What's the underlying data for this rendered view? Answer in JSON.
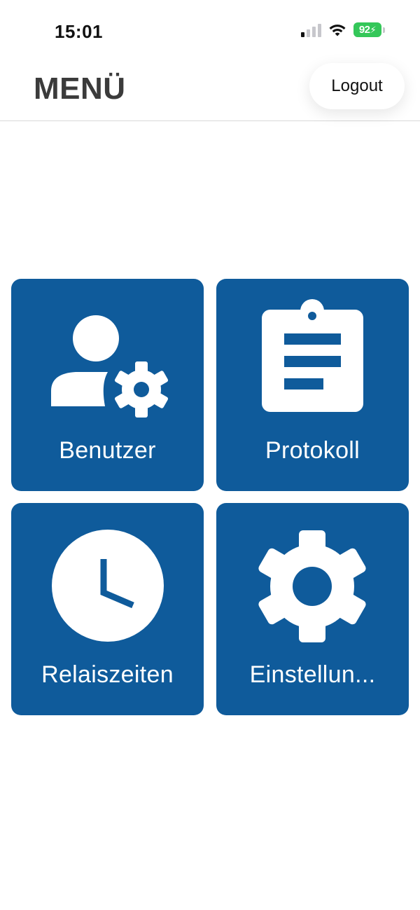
{
  "status_bar": {
    "time": "15:01",
    "battery_percent": "92",
    "signal_bars_active": 1,
    "signal_bars_total": 4,
    "icons": [
      "cellular-signal-icon",
      "wifi-icon",
      "battery-charging-icon"
    ],
    "battery_color": "#34c759"
  },
  "header": {
    "title": "MENÜ",
    "logout_label": "Logout"
  },
  "tiles": [
    {
      "label": "Benutzer",
      "icon": "user-settings-icon"
    },
    {
      "label": "Protokoll",
      "icon": "clipboard-icon"
    },
    {
      "label": "Relaiszeiten",
      "icon": "clock-icon"
    },
    {
      "label": "Einstellun...",
      "icon": "gear-icon"
    }
  ],
  "colors": {
    "tile_background": "#0f5b9b",
    "title_text": "#3b3b3b",
    "background": "#ffffff"
  }
}
